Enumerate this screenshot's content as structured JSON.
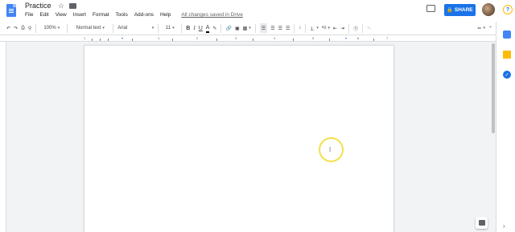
{
  "header": {
    "title": "Practice",
    "star": "☆",
    "menu": [
      "File",
      "Edit",
      "View",
      "Insert",
      "Format",
      "Tools",
      "Add-ons",
      "Help"
    ],
    "saved_status": "All changes saved in Drive",
    "share_label": "SHARE",
    "lock_icon": "🔒"
  },
  "toolbar": {
    "zoom": "100%",
    "style": "Normal text",
    "font": "Arial",
    "font_size": "11",
    "bold": "B",
    "italic": "I",
    "underline": "U",
    "text_color": "A"
  },
  "ruler": {
    "numbers": [
      "1",
      "1",
      "2",
      "3",
      "4",
      "5",
      "6",
      "7"
    ]
  },
  "colors": {
    "share_blue": "#1a73e8",
    "doc_blue": "#4285f4",
    "cursor_highlight": "#f4e04d",
    "keep_yellow": "#fbbc04",
    "calendar_blue": "#4285f4",
    "tasks_blue": "#1a73e8"
  }
}
